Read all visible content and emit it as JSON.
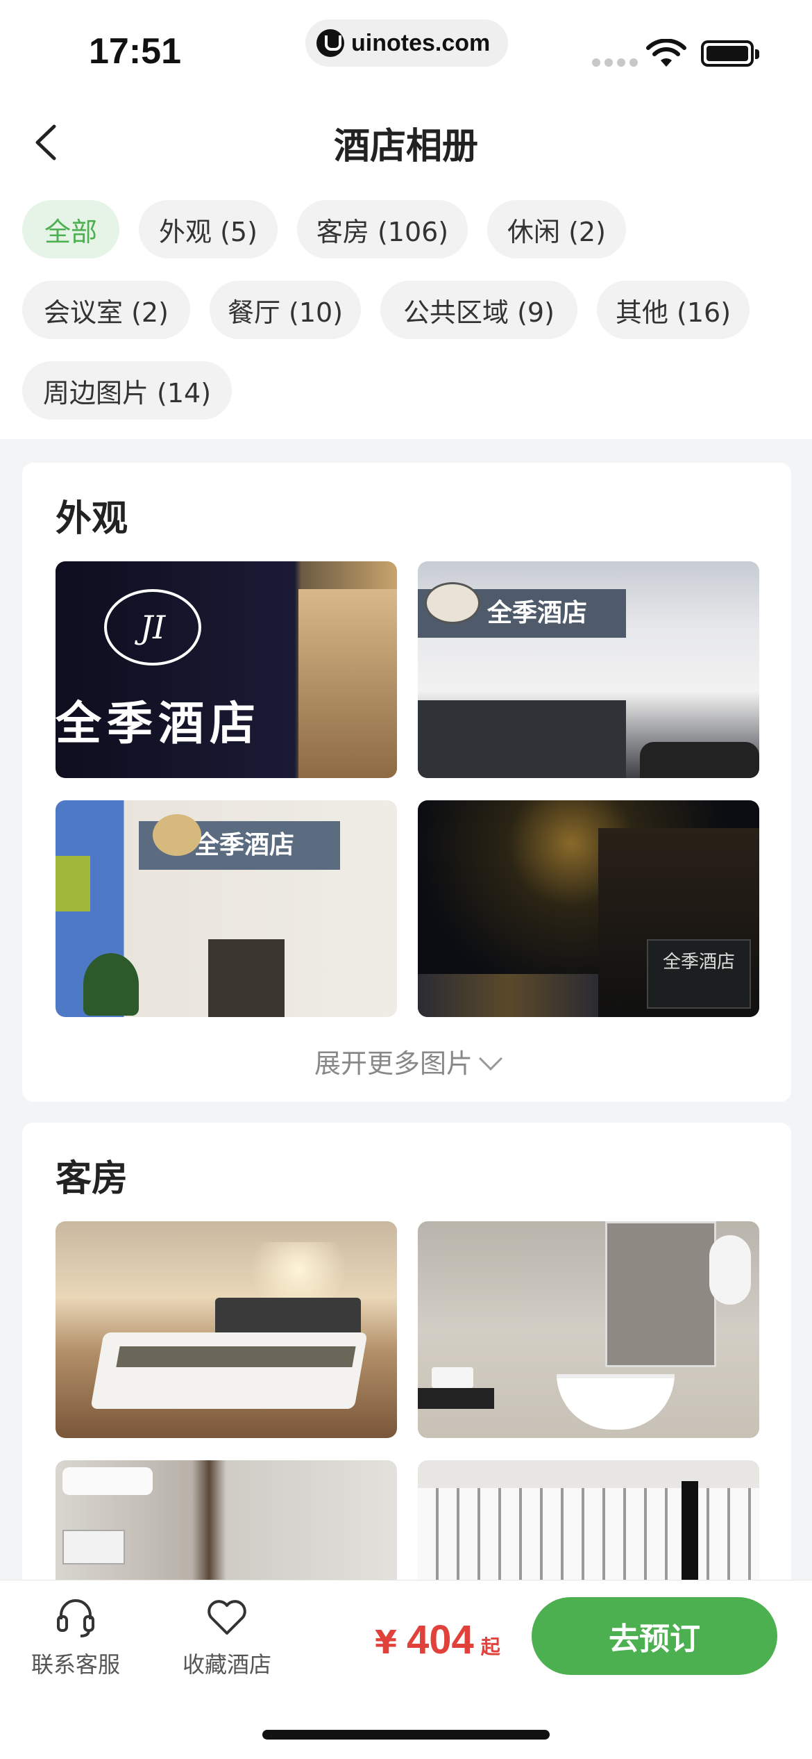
{
  "status_bar": {
    "time": "17:51",
    "url": "uinotes.com"
  },
  "header": {
    "title": "酒店相册"
  },
  "filters": [
    {
      "label": "全部",
      "active": true
    },
    {
      "label": "外观 (5)"
    },
    {
      "label": "客房 (106)"
    },
    {
      "label": "休闲 (2)"
    },
    {
      "label": "会议室 (2)"
    },
    {
      "label": "餐厅 (10)"
    },
    {
      "label": "公共区域 (9)"
    },
    {
      "label": "其他 (16)"
    },
    {
      "label": "周边图片 (14)"
    }
  ],
  "sections": [
    {
      "title": "外观",
      "photos": [
        {
          "sign_text": "全季酒店",
          "logo_text": "JI"
        },
        {
          "sign_text": "全季酒店"
        },
        {
          "sign_text": "全季酒店"
        },
        {
          "sign_text": "全季酒店"
        }
      ],
      "expand_label": "展开更多图片"
    },
    {
      "title": "客房"
    }
  ],
  "bottom_bar": {
    "service_label": "联系客服",
    "favorite_label": "收藏酒店",
    "currency": "¥",
    "price": "404",
    "price_suffix": "起",
    "book_label": "去预订"
  },
  "colors": {
    "accent": "#4caf50",
    "price": "#e0413b",
    "chip_bg": "#f2f2f2",
    "page_bg": "#f3f4f6"
  }
}
